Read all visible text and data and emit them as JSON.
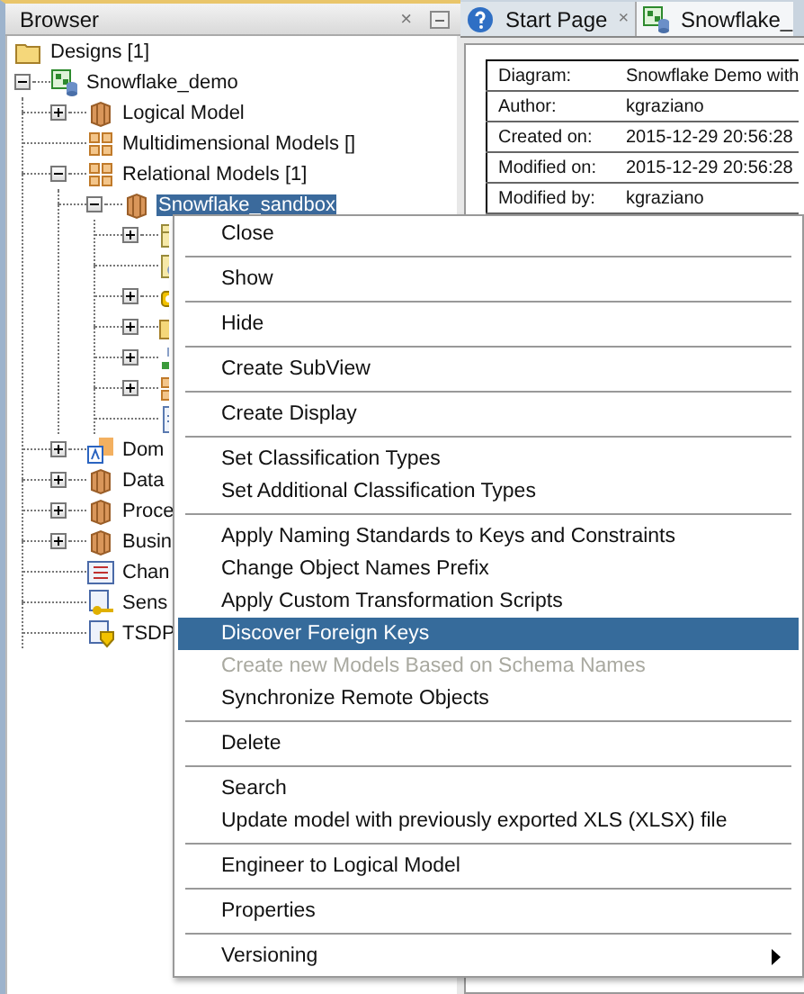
{
  "browser": {
    "title": "Browser",
    "close": "×",
    "tree": [
      {
        "label": "Designs [1]",
        "kind": "folder",
        "selected": false,
        "children": [
          {
            "label": "Snowflake_demo",
            "kind": "design",
            "expanded": true,
            "selected": false,
            "children": [
              {
                "label": "Logical Model",
                "kind": "cube",
                "expanded": false,
                "selected": false
              },
              {
                "label": "Multidimensional Models []",
                "kind": "grid",
                "selected": false
              },
              {
                "label": "Relational Models [1]",
                "kind": "grid",
                "expanded": true,
                "selected": false,
                "children": [
                  {
                    "label": "Snowflake_sandbox",
                    "kind": "cube",
                    "expanded": true,
                    "selected": true,
                    "children": [
                      {
                        "kind": "table",
                        "expanded": false,
                        "selected": false
                      },
                      {
                        "kind": "view",
                        "selected": false
                      },
                      {
                        "kind": "key",
                        "expanded": false,
                        "selected": false
                      },
                      {
                        "kind": "folder",
                        "expanded": false,
                        "selected": false
                      },
                      {
                        "kind": "link",
                        "expanded": false,
                        "selected": false
                      },
                      {
                        "kind": "grid",
                        "expanded": false,
                        "selected": false
                      },
                      {
                        "kind": "doc",
                        "selected": false
                      }
                    ]
                  }
                ]
              },
              {
                "label": "Dom",
                "kind": "domain",
                "expanded": false,
                "selected": false
              },
              {
                "label": "Data",
                "kind": "cube",
                "expanded": false,
                "selected": false
              },
              {
                "label": "Proce",
                "kind": "cube",
                "expanded": false,
                "selected": false
              },
              {
                "label": "Busin",
                "kind": "cube",
                "expanded": false,
                "selected": false
              },
              {
                "label": "Chan",
                "kind": "list",
                "selected": false
              },
              {
                "label": "Sens",
                "kind": "keydoc",
                "selected": false
              },
              {
                "label": "TSDP",
                "kind": "shield",
                "selected": false
              }
            ]
          }
        ]
      }
    ]
  },
  "editor": {
    "tabs": [
      {
        "label": "Start Page",
        "kind": "help",
        "close": "×",
        "selected": false
      },
      {
        "label": "Snowflake_",
        "kind": "design",
        "selected": true
      }
    ],
    "properties": [
      {
        "name": "Diagram:",
        "value": "Snowflake Demo with"
      },
      {
        "name": "Author:",
        "value": "kgraziano"
      },
      {
        "name": "Created on:",
        "value": "2015-12-29 20:56:28"
      },
      {
        "name": "Modified on:",
        "value": "2015-12-29 20:56:28"
      },
      {
        "name": "Modified by:",
        "value": "kgraziano"
      }
    ]
  },
  "context_menu": [
    [
      {
        "label": "Close",
        "selected": false,
        "disabled": false,
        "submenu": false
      }
    ],
    [
      {
        "label": "Show",
        "selected": false,
        "disabled": false,
        "submenu": false
      }
    ],
    [
      {
        "label": "Hide",
        "selected": false,
        "disabled": false,
        "submenu": false
      }
    ],
    [
      {
        "label": "Create SubView",
        "selected": false,
        "disabled": false,
        "submenu": false
      }
    ],
    [
      {
        "label": "Create Display",
        "selected": false,
        "disabled": false,
        "submenu": false
      }
    ],
    [
      {
        "label": "Set Classification Types",
        "selected": false,
        "disabled": false,
        "submenu": false
      },
      {
        "label": "Set Additional Classification Types",
        "selected": false,
        "disabled": false,
        "submenu": false
      }
    ],
    [
      {
        "label": "Apply Naming Standards to Keys and Constraints",
        "selected": false,
        "disabled": false,
        "submenu": false
      },
      {
        "label": "Change Object Names Prefix",
        "selected": false,
        "disabled": false,
        "submenu": false
      },
      {
        "label": "Apply Custom Transformation Scripts",
        "selected": false,
        "disabled": false,
        "submenu": false
      },
      {
        "label": "Discover Foreign Keys",
        "selected": true,
        "disabled": false,
        "submenu": false
      },
      {
        "label": "Create new Models Based on Schema Names",
        "selected": false,
        "disabled": true,
        "submenu": false
      },
      {
        "label": "Synchronize Remote Objects",
        "selected": false,
        "disabled": false,
        "submenu": false
      }
    ],
    [
      {
        "label": "Delete",
        "selected": false,
        "disabled": false,
        "submenu": false
      }
    ],
    [
      {
        "label": "Search",
        "selected": false,
        "disabled": false,
        "submenu": false
      },
      {
        "label": "Update model with previously exported XLS (XLSX) file",
        "selected": false,
        "disabled": false,
        "submenu": false
      }
    ],
    [
      {
        "label": "Engineer to Logical Model",
        "selected": false,
        "disabled": false,
        "submenu": false
      }
    ],
    [
      {
        "label": "Properties",
        "selected": false,
        "disabled": false,
        "submenu": false
      }
    ],
    [
      {
        "label": "Versioning",
        "selected": false,
        "disabled": false,
        "submenu": true
      }
    ]
  ]
}
